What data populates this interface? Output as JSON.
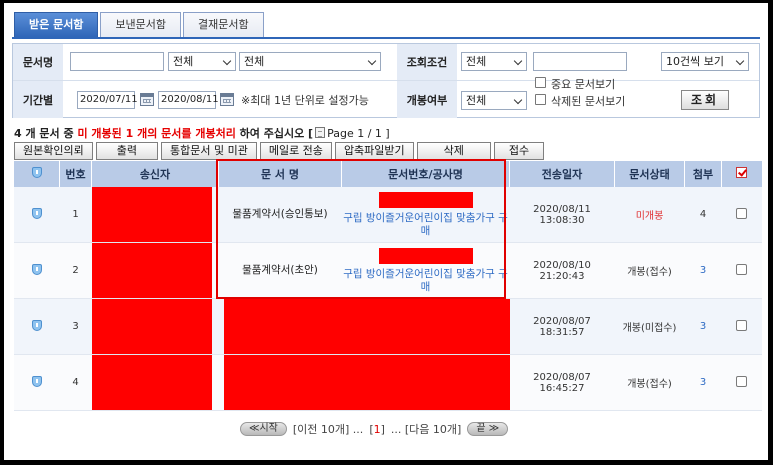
{
  "tabs": [
    {
      "label": "받은 문서함",
      "active": true
    },
    {
      "label": "보낸문서함",
      "active": false
    },
    {
      "label": "결재문서함",
      "active": false
    }
  ],
  "search": {
    "doc_name_label": "문서명",
    "doc_name_value": "",
    "type_select": "전체",
    "sub_select": "전체",
    "condition_label": "조회조건",
    "condition_select": "전체",
    "condition_value": "",
    "page_size_select": "10건씩 보기",
    "period_label": "기간별",
    "date_from": "2020/07/11",
    "date_to": "2020/08/11",
    "period_note": "※최대 1년 단위로 설정가능",
    "open_label": "개봉여부",
    "open_select": "전체",
    "important_label": "중요 문서보기",
    "deleted_label": "삭제된 문서보기",
    "search_button": "조회"
  },
  "info": {
    "count_part": "4 개 문서 중 ",
    "unread_part": "미 개봉된 1 개의 문서를 개봉처리",
    "suffix_part": " 하여 주십시오 [",
    "page_text": "Page 1 / 1 ]"
  },
  "toolbar": [
    "원본확인의뢰",
    "출력",
    "통합문서 및 미관",
    "메일로 전송",
    "압축파일받기",
    "삭제",
    "접수"
  ],
  "table": {
    "headers": {
      "no": "번호",
      "sender": "송신자",
      "doc_name": "문 서 명",
      "doc_no": "문서번호/공사명",
      "sent_at": "전송일자",
      "status": "문서상태",
      "attach": "첨부"
    },
    "rows": [
      {
        "no": "1",
        "doc_name": "물품계약서(승인통보)",
        "doc_no": "구립 방이즐거운어린이집 맞춤가구 구매",
        "sent_at": "2020/08/11 13:08:30",
        "status": "미개봉",
        "attach": "4"
      },
      {
        "no": "2",
        "doc_name": "물품계약서(초안)",
        "doc_no": "구립 방이즐거운어린이집 맞춤가구 구매",
        "sent_at": "2020/08/10 21:20:43",
        "status": "개봉(접수)",
        "attach": "3"
      },
      {
        "no": "3",
        "doc_name": "",
        "doc_no": "",
        "sent_at": "2020/08/07 18:31:57",
        "status": "개봉(미접수)",
        "attach": "3"
      },
      {
        "no": "4",
        "doc_name": "",
        "doc_no": "",
        "sent_at": "2020/08/07 16:45:27",
        "status": "개봉(접수)",
        "attach": "3"
      }
    ]
  },
  "pager": {
    "first": "≪시작",
    "prev": "[이전 10개] ...",
    "current": "1",
    "next": "... [다음 10개]",
    "last": "끝 ≫"
  },
  "colors": {
    "accent": "#2f66b8",
    "redaction": "#ff0000",
    "unread": "#e03030",
    "link": "#2e6bc4"
  }
}
